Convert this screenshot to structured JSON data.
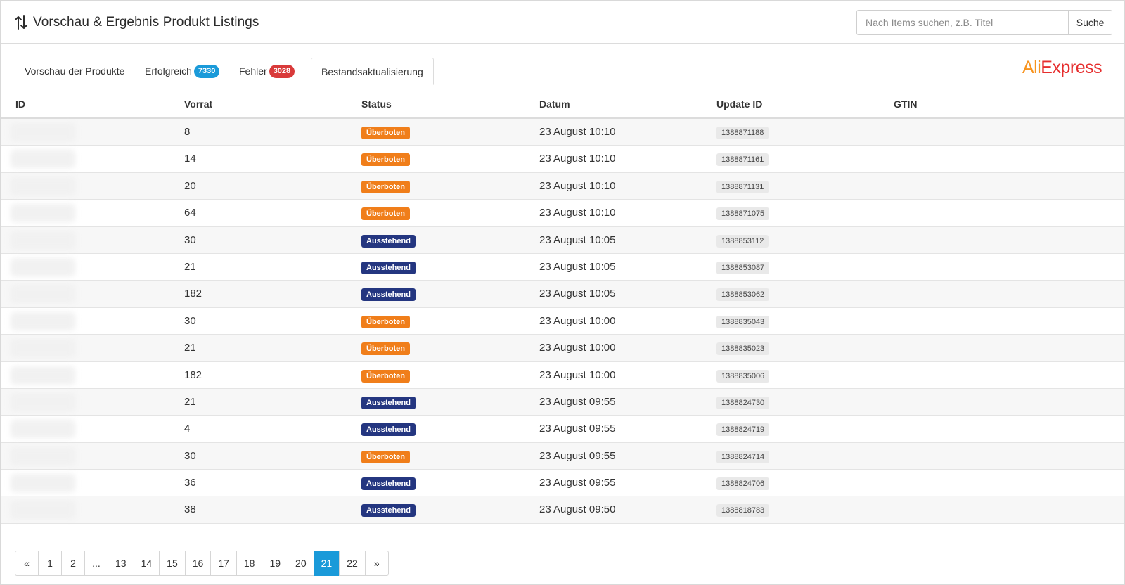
{
  "header": {
    "title": "Vorschau & Ergebnis Produkt Listings",
    "title_icon": "sort-arrows-icon",
    "search_placeholder": "Nach Items suchen, z.B. Titel",
    "search_button": "Suche"
  },
  "tabs": [
    {
      "label": "Vorschau der Produkte",
      "badge": null
    },
    {
      "label": "Erfolgreich",
      "badge": "7330",
      "badge_color": "#1a9ad9"
    },
    {
      "label": "Fehler",
      "badge": "3028",
      "badge_color": "#d93a3a"
    },
    {
      "label": "Bestandsaktualisierung",
      "badge": null,
      "active": true
    }
  ],
  "brand": {
    "part1": "Ali",
    "part2": "Express"
  },
  "table": {
    "columns": [
      "ID",
      "Vorrat",
      "Status",
      "Datum",
      "Update ID",
      "GTIN"
    ],
    "rows": [
      {
        "vorrat": "8",
        "status": "Überboten",
        "datum": "23 August 10:10",
        "update_id": "1388871188"
      },
      {
        "vorrat": "14",
        "status": "Überboten",
        "datum": "23 August 10:10",
        "update_id": "1388871161"
      },
      {
        "vorrat": "20",
        "status": "Überboten",
        "datum": "23 August 10:10",
        "update_id": "1388871131"
      },
      {
        "vorrat": "64",
        "status": "Überboten",
        "datum": "23 August 10:10",
        "update_id": "1388871075"
      },
      {
        "vorrat": "30",
        "status": "Ausstehend",
        "datum": "23 August 10:05",
        "update_id": "1388853112"
      },
      {
        "vorrat": "21",
        "status": "Ausstehend",
        "datum": "23 August 10:05",
        "update_id": "1388853087"
      },
      {
        "vorrat": "182",
        "status": "Ausstehend",
        "datum": "23 August 10:05",
        "update_id": "1388853062"
      },
      {
        "vorrat": "30",
        "status": "Überboten",
        "datum": "23 August 10:00",
        "update_id": "1388835043"
      },
      {
        "vorrat": "21",
        "status": "Überboten",
        "datum": "23 August 10:00",
        "update_id": "1388835023"
      },
      {
        "vorrat": "182",
        "status": "Überboten",
        "datum": "23 August 10:00",
        "update_id": "1388835006"
      },
      {
        "vorrat": "21",
        "status": "Ausstehend",
        "datum": "23 August 09:55",
        "update_id": "1388824730"
      },
      {
        "vorrat": "4",
        "status": "Ausstehend",
        "datum": "23 August 09:55",
        "update_id": "1388824719"
      },
      {
        "vorrat": "30",
        "status": "Überboten",
        "datum": "23 August 09:55",
        "update_id": "1388824714"
      },
      {
        "vorrat": "36",
        "status": "Ausstehend",
        "datum": "23 August 09:55",
        "update_id": "1388824706"
      },
      {
        "vorrat": "38",
        "status": "Ausstehend",
        "datum": "23 August 09:50",
        "update_id": "1388818783"
      }
    ]
  },
  "status_colors": {
    "Überboten": "#f07e1a",
    "Ausstehend": "#243680"
  },
  "pagination": {
    "pages": [
      "«",
      "1",
      "2",
      "...",
      "13",
      "14",
      "15",
      "16",
      "17",
      "18",
      "19",
      "20",
      "21",
      "22",
      "»"
    ],
    "current": "21"
  }
}
